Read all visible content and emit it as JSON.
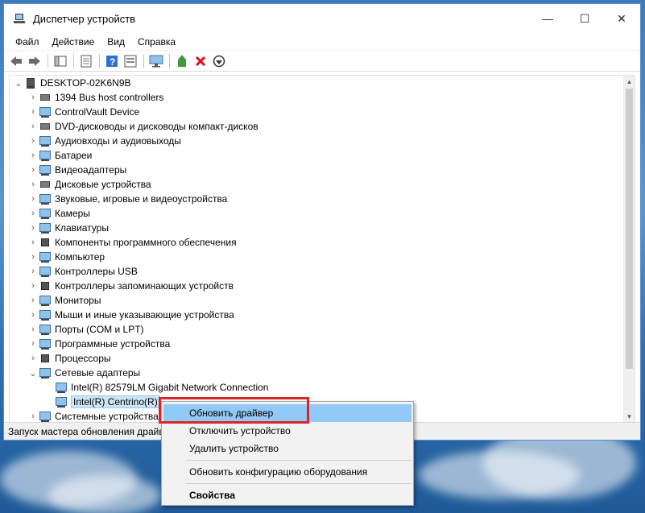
{
  "window": {
    "title": "Диспетчер устройств",
    "minimize_glyph": "—",
    "maximize_glyph": "☐",
    "close_glyph": "✕"
  },
  "menu": [
    "Файл",
    "Действие",
    "Вид",
    "Справка"
  ],
  "toolbar_icons": [
    "back-icon",
    "forward-icon",
    "show-hide-tree-icon",
    "properties-icon",
    "help-icon",
    "view-resources-icon",
    "monitor-icon",
    "update-driver-icon",
    "uninstall-icon",
    "scan-hardware-icon"
  ],
  "tree": {
    "root": "DESKTOP-02K6N9B",
    "categories": [
      {
        "label": "1394 Bus host controllers",
        "icon": "usb-plug-icon"
      },
      {
        "label": "ControlVault Device",
        "icon": "monitor-icon"
      },
      {
        "label": "DVD-дисководы и дисководы компакт-дисков",
        "icon": "dvd-drive-icon"
      },
      {
        "label": "Аудиовходы и аудиовыходы",
        "icon": "speaker-icon"
      },
      {
        "label": "Батареи",
        "icon": "battery-icon"
      },
      {
        "label": "Видеоадаптеры",
        "icon": "display-adapter-icon"
      },
      {
        "label": "Дисковые устройства",
        "icon": "disk-drive-icon"
      },
      {
        "label": "Звуковые, игровые и видеоустройства",
        "icon": "sound-icon"
      },
      {
        "label": "Камеры",
        "icon": "camera-icon"
      },
      {
        "label": "Клавиатуры",
        "icon": "keyboard-icon"
      },
      {
        "label": "Компоненты программного обеспечения",
        "icon": "software-component-icon"
      },
      {
        "label": "Компьютер",
        "icon": "computer-icon"
      },
      {
        "label": "Контроллеры USB",
        "icon": "usb-controller-icon"
      },
      {
        "label": "Контроллеры запоминающих устройств",
        "icon": "storage-controller-icon"
      },
      {
        "label": "Мониторы",
        "icon": "monitor-icon"
      },
      {
        "label": "Мыши и иные указывающие устройства",
        "icon": "mouse-icon"
      },
      {
        "label": "Порты (COM и LPT)",
        "icon": "port-icon"
      },
      {
        "label": "Программные устройства",
        "icon": "software-device-icon"
      },
      {
        "label": "Процессоры",
        "icon": "processor-icon"
      },
      {
        "label": "Сетевые адаптеры",
        "icon": "network-adapter-icon",
        "expanded": true,
        "children": [
          {
            "label": "Intel(R) 82579LM Gigabit Network Connection",
            "icon": "network-adapter-icon"
          },
          {
            "label": "Intel(R) Centrino(R)",
            "icon": "network-adapter-icon",
            "selected": true
          }
        ]
      },
      {
        "label": "Системные устройства",
        "icon": "system-device-icon"
      }
    ]
  },
  "status_bar": "Запуск мастера обновления драйв",
  "context_menu": {
    "items": [
      {
        "label": "Обновить драйвер",
        "highlighted": true
      },
      {
        "label": "Отключить устройство"
      },
      {
        "label": "Удалить устройство"
      },
      {
        "separator": true
      },
      {
        "label": "Обновить конфигурацию оборудования"
      },
      {
        "separator": true
      },
      {
        "label": "Свойства",
        "bold": true
      }
    ]
  },
  "colors": {
    "highlight": "#91c9f7",
    "annotation_frame": "#d9262b",
    "selection": "#cce4f7"
  }
}
